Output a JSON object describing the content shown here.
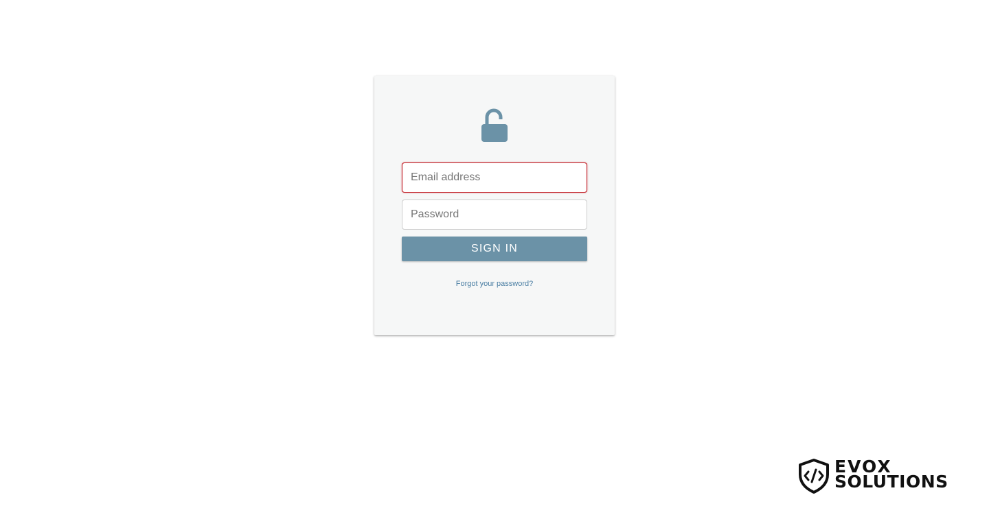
{
  "login": {
    "email_placeholder": "Email address",
    "password_placeholder": "Password",
    "signin_label": "SIGN IN",
    "forgot_label": "Forgot your password?"
  },
  "icons": {
    "lock": "unlocked-padlock-icon",
    "logo_shield": "shield-code-icon"
  },
  "brand": {
    "line1": "EVOX",
    "line2": "SOLUTIONS"
  },
  "colors": {
    "accent": "#6b92a7",
    "card_background": "#f6f7f7",
    "error_border": "#c0161e",
    "link": "#4a7ea3"
  }
}
